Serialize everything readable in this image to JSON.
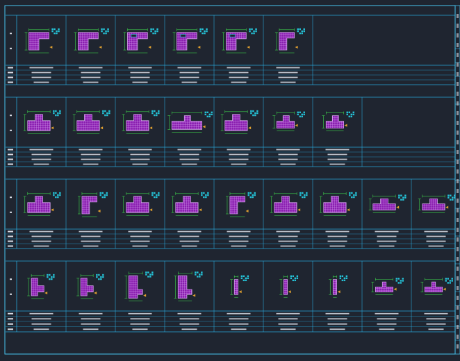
{
  "colors": {
    "background": "#1f2530",
    "grid_line": "#2aa6d8",
    "frame_line": "#47c5f0",
    "column_fill": "#8a1fb0",
    "rebar_grid": "#d8a0f0",
    "hatch": "#25c3d8",
    "dimension": "#3ed34b",
    "annotation": "#e0a030",
    "table_text": "#d8dde6"
  },
  "rows": [
    {
      "cells": [
        {
          "shape": "L-corner"
        },
        {
          "shape": "L-corner"
        },
        {
          "shape": "L-corner-opening"
        },
        {
          "shape": "L-corner-opening"
        },
        {
          "shape": "L-corner-opening"
        },
        {
          "shape": "L-narrow"
        }
      ]
    },
    {
      "cells": [
        {
          "shape": "T-wide"
        },
        {
          "shape": "T-wide"
        },
        {
          "shape": "T-wide"
        },
        {
          "shape": "T-wall"
        },
        {
          "shape": "T-wide"
        },
        {
          "shape": "T-small"
        },
        {
          "shape": "T-small"
        }
      ]
    },
    {
      "cells": [
        {
          "shape": "T-wide"
        },
        {
          "shape": "L-narrow"
        },
        {
          "shape": "T-wide"
        },
        {
          "shape": "T-wide"
        },
        {
          "shape": "L-narrow"
        },
        {
          "shape": "T-wide"
        },
        {
          "shape": "T-wide"
        },
        {
          "shape": "T-low"
        },
        {
          "shape": "T-low"
        }
      ]
    },
    {
      "cells": [
        {
          "shape": "L-flange"
        },
        {
          "shape": "L-flange"
        },
        {
          "shape": "L-flange-tall"
        },
        {
          "shape": "L-flange-tall"
        },
        {
          "shape": "bar"
        },
        {
          "shape": "bar"
        },
        {
          "shape": "bar"
        },
        {
          "shape": "T-cap"
        },
        {
          "shape": "T-cap"
        }
      ]
    }
  ]
}
